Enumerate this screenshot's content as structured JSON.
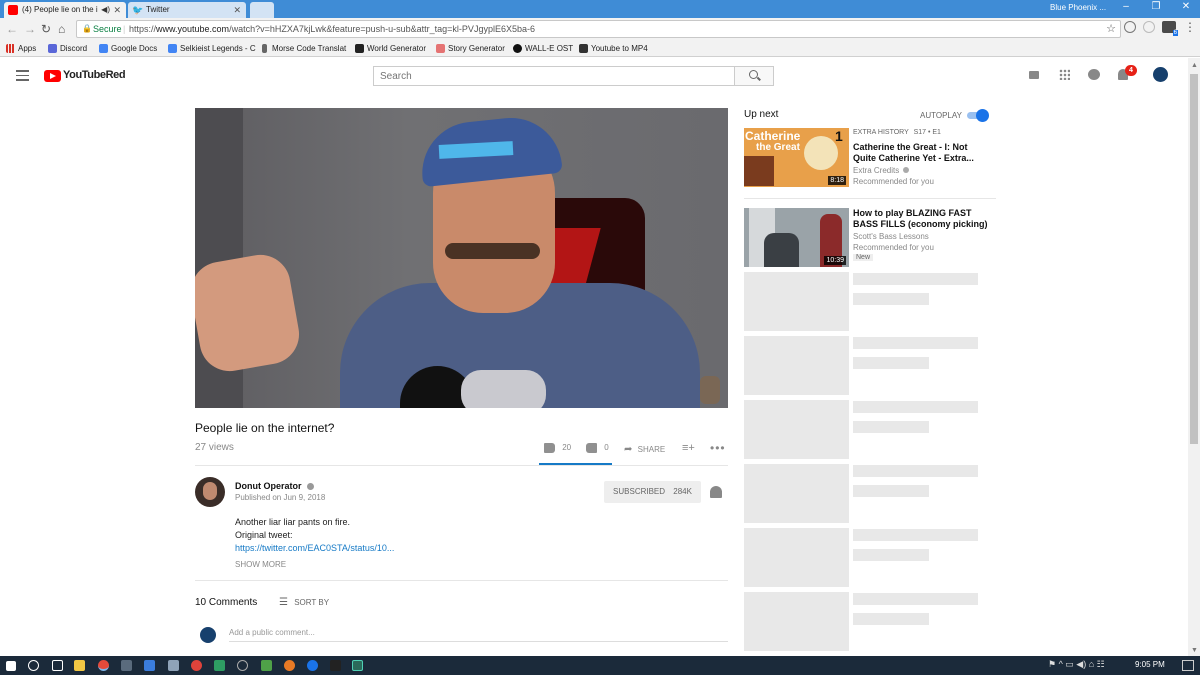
{
  "browser": {
    "tabs": [
      {
        "label": "(4) People lie on the i",
        "active": true
      },
      {
        "label": "Twitter",
        "active": false
      }
    ],
    "profile_name": "Blue Phoenix ...",
    "secure_label": "Secure",
    "url_prefix": "https://",
    "url_host": "www.youtube.com",
    "url_path": "/watch?v=hHZXA7kjLwk&feature=push-u-sub&attr_tag=kl-PVJgyplE6X5ba-6",
    "bookmarks": [
      "Apps",
      "Discord",
      "Google Docs",
      "Selkieist Legends - C",
      "Morse Code Translat",
      "World Generator",
      "Story Generator",
      "WALL-E OST",
      "Youtube to MP4"
    ],
    "ext_badge": "6"
  },
  "masthead": {
    "logo_text": "YouTube",
    "logo_suffix": "Red",
    "search_placeholder": "Search",
    "notification_count": "4"
  },
  "video": {
    "title": "People lie on the internet?",
    "views": "27 views",
    "likes": "20",
    "dislikes": "0",
    "share_label": "SHARE",
    "channel": "Donut Operator",
    "published": "Published on Jun 9, 2018",
    "subscribe_label": "SUBSCRIBED",
    "subscriber_count": "284K",
    "description_line1": "Another liar liar pants on fire.",
    "description_line2": "Original tweet:",
    "description_link": "https://twitter.com/EAC0STA/status/10...",
    "show_more": "SHOW MORE"
  },
  "comments": {
    "count_label": "10 Comments",
    "sort_label": "SORT BY",
    "placeholder": "Add a public comment..."
  },
  "sidebar": {
    "up_next": "Up next",
    "autoplay": "AUTOPLAY",
    "autoplay_on": true,
    "items": [
      {
        "series": "EXTRA HISTORY",
        "episode": "S17 • E1",
        "title_line1": "Catherine the Great - I: Not",
        "title_line2": "Quite Catherine Yet - Extra...",
        "channel": "Extra Credits",
        "meta": "Recommended for you",
        "duration": "8:18",
        "thumb_text_1": "Catherine",
        "thumb_text_2": "the Great",
        "thumb_number": "1"
      },
      {
        "title_line1": "How to play BLAZING FAST",
        "title_line2": "BASS FILLS (economy picking)",
        "channel": "Scott's Bass Lessons",
        "meta": "Recommended for you",
        "badge": "New",
        "duration": "10:39"
      }
    ]
  },
  "taskbar": {
    "time": "9:05 PM"
  },
  "colors": {
    "youtube_red": "#ff0000",
    "link_blue": "#167ac6",
    "toggle_blue": "#1a73e8",
    "tab_strip": "#3f8cd6",
    "taskbar": "#1b2a3a"
  }
}
